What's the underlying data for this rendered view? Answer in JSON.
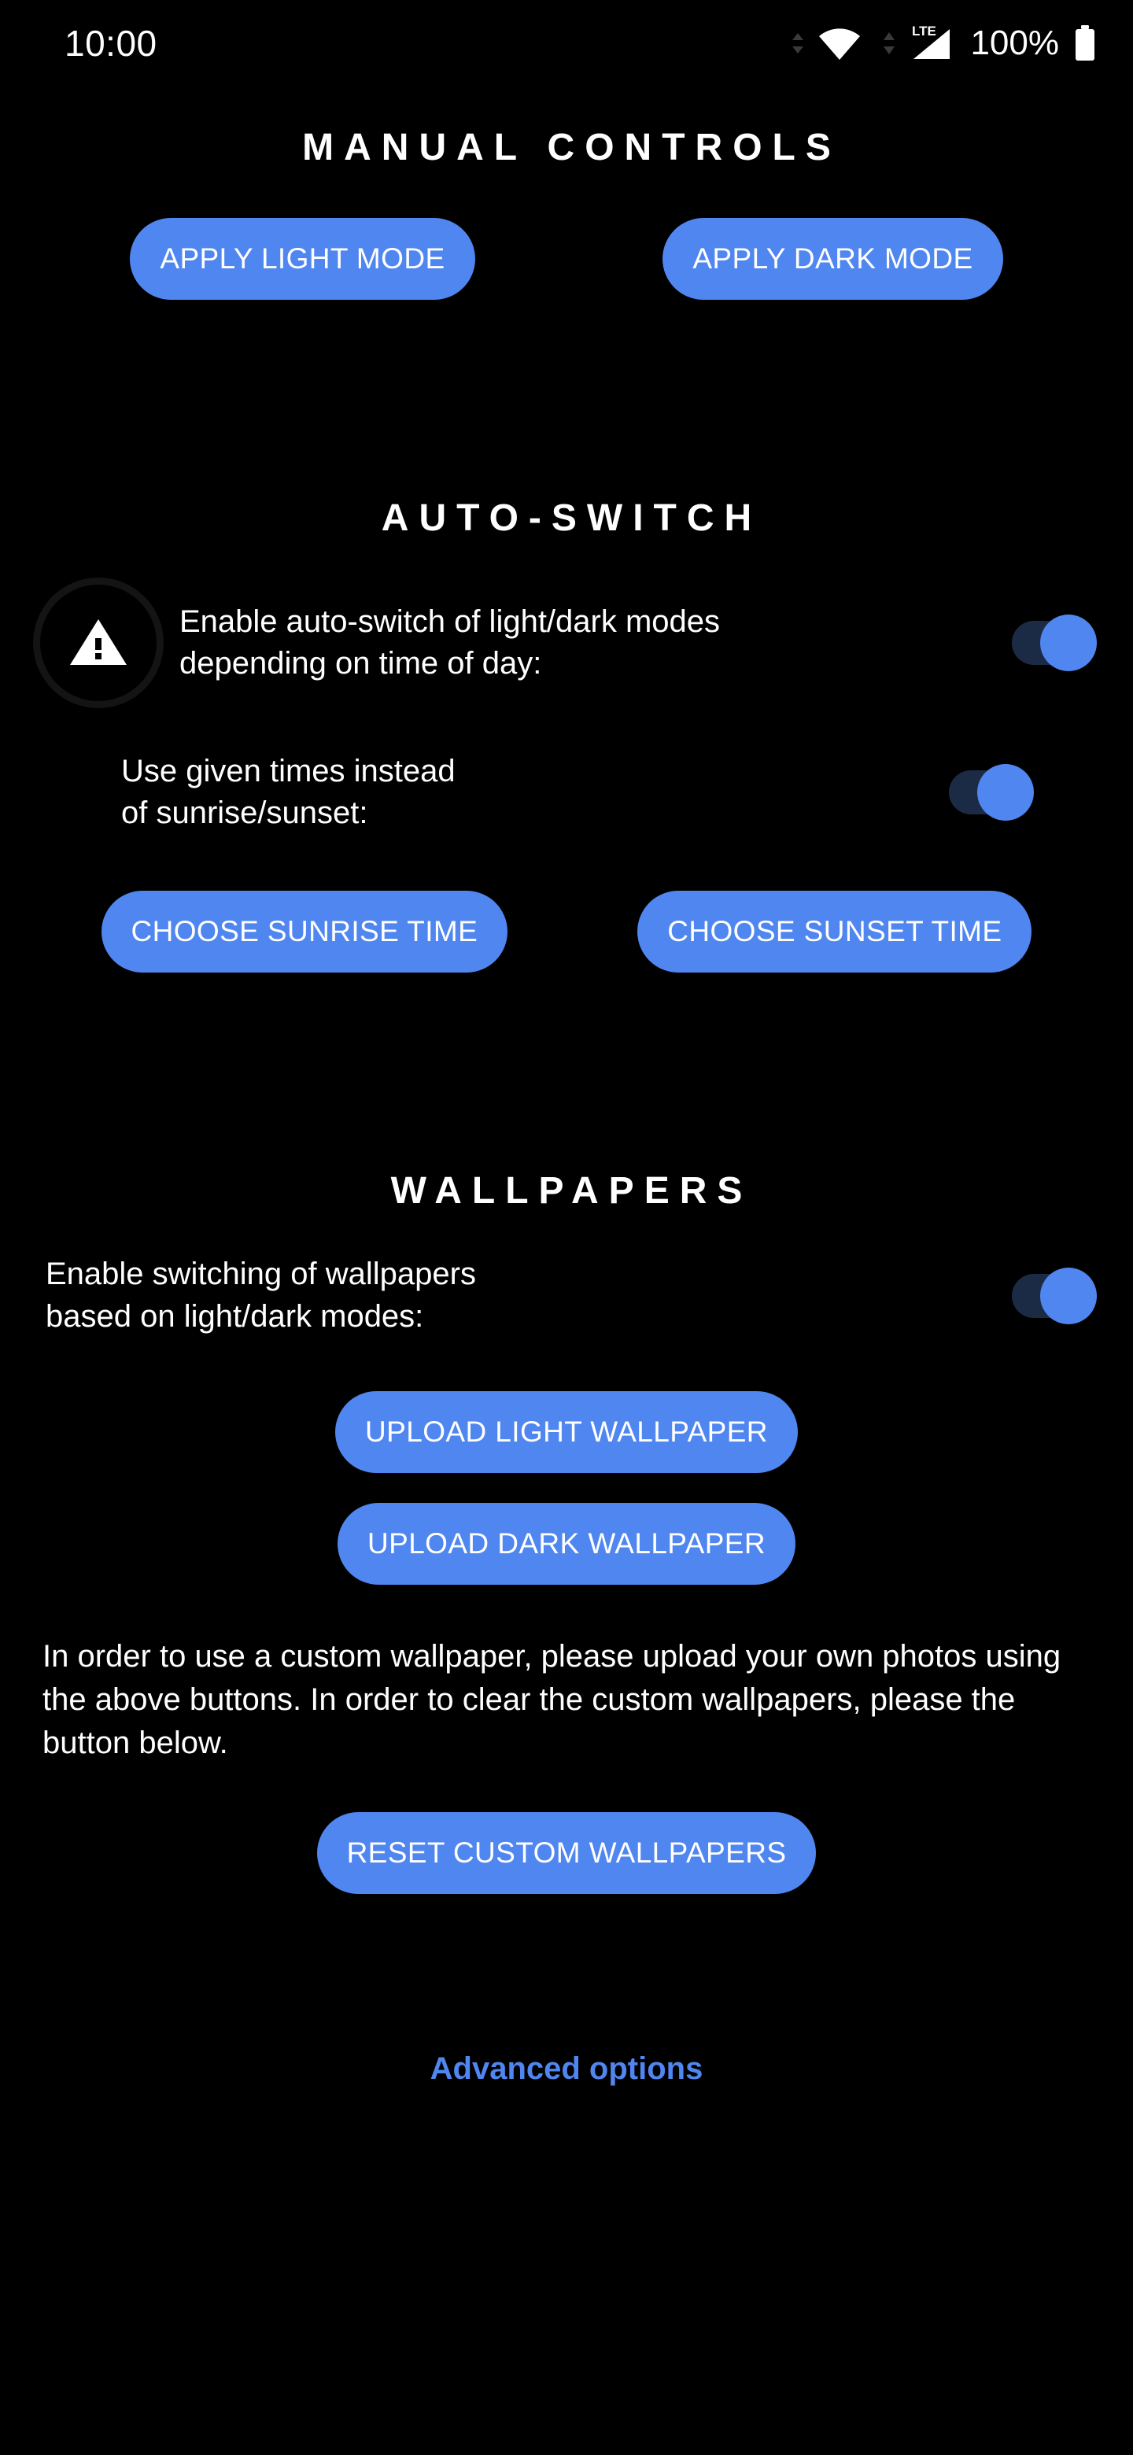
{
  "status_bar": {
    "clock": "10:00",
    "battery_percent": "100%",
    "icons": {
      "wifi": "wifi-icon",
      "signal": "lte-signal-icon",
      "signal_label": "LTE",
      "battery": "battery-full-icon",
      "data_arrows": "data-transfer-arrows-icon"
    }
  },
  "colors": {
    "background": "#000000",
    "accent_blue": "#5086F0",
    "toggle_track": "#1C2B45",
    "text_primary": "#FFFFFF",
    "ripple": "#141414"
  },
  "manual_controls": {
    "title": "MANUAL CONTROLS",
    "apply_light_label": "APPLY LIGHT MODE",
    "apply_dark_label": "APPLY DARK MODE"
  },
  "auto_switch": {
    "title": "AUTO-SWITCH",
    "enable_label_line1": "Enable auto-switch of light/dark modes",
    "enable_label_line2": "depending on time of day:",
    "enable_toggle_state": "on",
    "given_times_label_line1": "Use given times instead",
    "given_times_label_line2": "of sunrise/sunset:",
    "given_times_toggle_state": "on",
    "choose_sunrise_label": "CHOOSE SUNRISE TIME",
    "choose_sunset_label": "CHOOSE SUNSET TIME",
    "warning_icon": "warning-triangle-icon"
  },
  "wallpapers": {
    "title": "WALLPAPERS",
    "enable_label_line1": "Enable switching of wallpapers",
    "enable_label_line2": "based on light/dark modes:",
    "enable_toggle_state": "on",
    "upload_light_label": "UPLOAD LIGHT WALLPAPER",
    "upload_dark_label": "UPLOAD DARK WALLPAPER",
    "description": "In order to use a custom wallpaper, please upload your own photos using the above buttons. In order to clear the custom wallpapers, please the button below.",
    "reset_label": "RESET CUSTOM WALLPAPERS"
  },
  "footer": {
    "advanced_options_label": "Advanced options"
  }
}
